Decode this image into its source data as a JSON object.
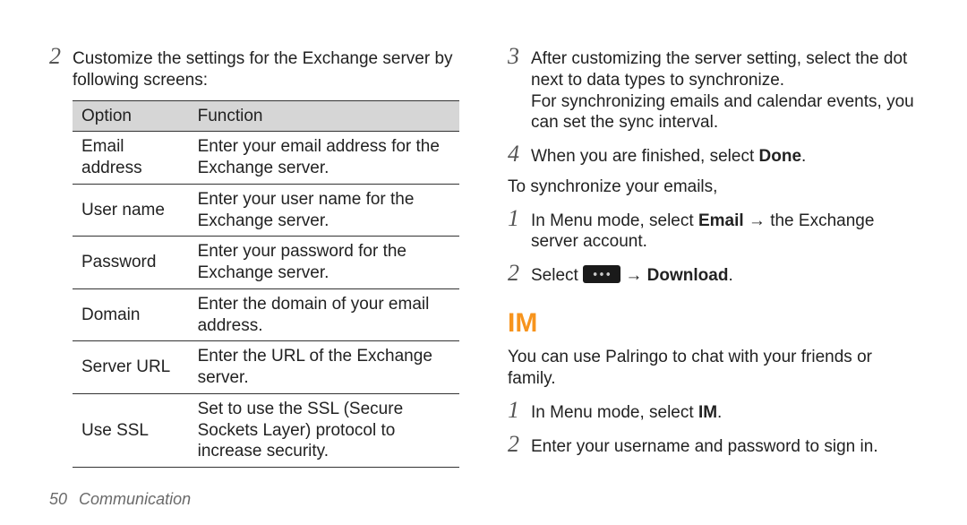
{
  "left": {
    "step2": {
      "num": "2",
      "text": "Customize the settings for the Exchange server by following screens:"
    },
    "table": {
      "head_option": "Option",
      "head_function": "Function",
      "rows": [
        {
          "opt": "Email address",
          "fn": "Enter your email address for the Exchange server."
        },
        {
          "opt": "User name",
          "fn": "Enter your user name for the Exchange server."
        },
        {
          "opt": "Password",
          "fn": "Enter your password for the Exchange server."
        },
        {
          "opt": "Domain",
          "fn": "Enter the domain of your email address."
        },
        {
          "opt": "Server URL",
          "fn": "Enter the URL of the Exchange server."
        },
        {
          "opt": "Use SSL",
          "fn": "Set to use the SSL (Secure Sockets Layer) protocol to increase security."
        }
      ]
    }
  },
  "right": {
    "step3": {
      "num": "3",
      "line1": "After customizing the server setting, select the dot next to data types to synchronize.",
      "line2": "For synchronizing emails and calendar events, you can set the sync interval."
    },
    "step4": {
      "num": "4",
      "prefix": "When you are finished, select ",
      "bold": "Done",
      "suffix": "."
    },
    "sync_intro": "To synchronize your emails,",
    "sync_step1": {
      "num": "1",
      "prefix": "In Menu mode, select ",
      "bold": "Email",
      "suffix": " → the Exchange server account."
    },
    "sync_step2": {
      "num": "2",
      "prefix": "Select ",
      "icon_name": "more-options-icon",
      "arrow": " → ",
      "bold": "Download",
      "suffix": "."
    },
    "im": {
      "heading": "IM",
      "intro": "You can use Palringo to chat with your friends or family.",
      "step1": {
        "num": "1",
        "prefix": "In Menu mode, select ",
        "bold": "IM",
        "suffix": "."
      },
      "step2": {
        "num": "2",
        "text": "Enter your username and password to sign in."
      }
    }
  },
  "footer": {
    "page": "50",
    "section": "Communication"
  }
}
